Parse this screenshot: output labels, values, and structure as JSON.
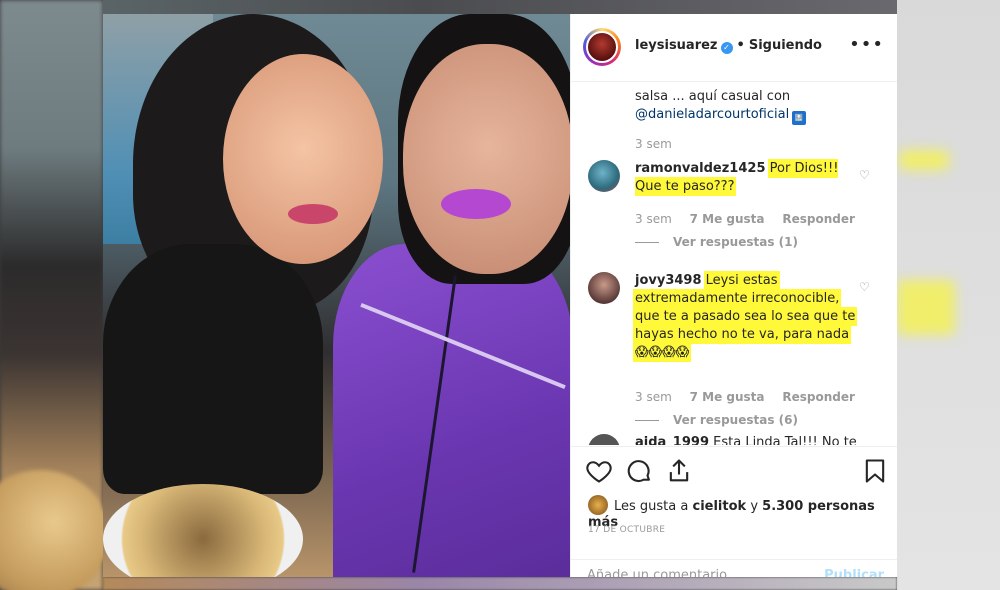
{
  "post": {
    "username": "leysisuarez",
    "follow_status": "Siguiendo",
    "caption_line1": "salsa ... aquí casual con",
    "caption_mention": "@danieladarcourtoficial",
    "caption_time": "3 sem"
  },
  "comments": [
    {
      "username": "ramonvaldez1425",
      "text": "Por Dios!!! Que te paso???",
      "time": "3 sem",
      "likes": "7 Me gusta",
      "reply_label": "Responder",
      "replies": "Ver respuestas (1)"
    },
    {
      "username": "jovy3498",
      "text_l1": "Leysi estas",
      "text_l2": "extremadamente irreconocible,",
      "text_l3": "que te a pasado sea lo sea que te",
      "text_l4": "hayas hecho no te va, para nada",
      "emojis": "😱😱😱😱",
      "time": "3 sem",
      "likes": "7 Me gusta",
      "reply_label": "Responder",
      "replies": "Ver respuestas (6)"
    },
    {
      "username_partial": "aida_1999",
      "text_partial": "Esta Linda Tal!!! No te"
    }
  ],
  "likes": {
    "prefix": "Les gusta a",
    "user": "cielitok",
    "connector": "y",
    "others": "5.300 personas más"
  },
  "date": "17 DE OCTUBRE",
  "add_comment": {
    "placeholder": "Añade un comentario...",
    "publish": "Publicar"
  },
  "colors": {
    "highlight": "#fff93a",
    "verified": "#3897f0",
    "mention": "#003569",
    "muted": "#999999"
  }
}
